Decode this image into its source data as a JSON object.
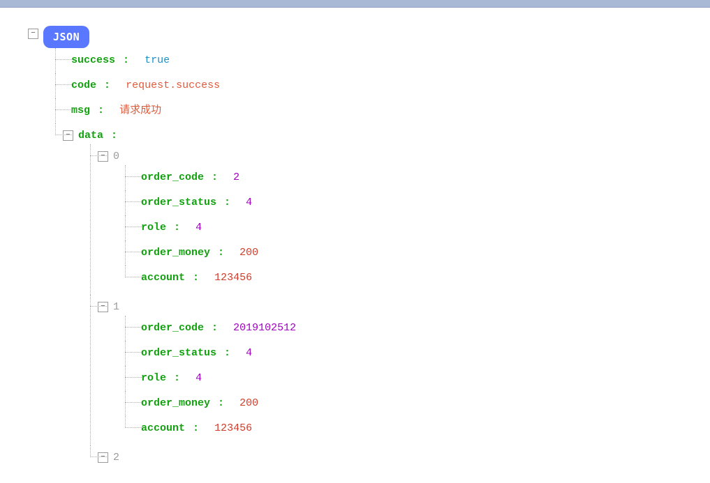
{
  "root_label": "JSON",
  "glyph_expanded": "−",
  "glyph_collapsed": "+",
  "colon": ":",
  "nodes": {
    "success": {
      "key": "success",
      "value": "true",
      "vclass": "v-bool"
    },
    "code": {
      "key": "code",
      "value": "request.success",
      "vclass": "v-str"
    },
    "msg": {
      "key": "msg",
      "value": "请求成功",
      "vclass": "v-str"
    },
    "data": {
      "key": "data"
    },
    "idx0": "0",
    "idx1": "1",
    "idx2": "2",
    "item0": {
      "order_code": {
        "key": "order_code",
        "value": "2",
        "vclass": "v-num"
      },
      "order_status": {
        "key": "order_status",
        "value": "4",
        "vclass": "v-num"
      },
      "role": {
        "key": "role",
        "value": "4",
        "vclass": "v-num"
      },
      "order_money": {
        "key": "order_money",
        "value": "200",
        "vclass": "v-numr"
      },
      "account": {
        "key": "account",
        "value": "123456",
        "vclass": "v-numr"
      }
    },
    "item1": {
      "order_code": {
        "key": "order_code",
        "value": "2019102512",
        "vclass": "v-num"
      },
      "order_status": {
        "key": "order_status",
        "value": "4",
        "vclass": "v-num"
      },
      "role": {
        "key": "role",
        "value": "4",
        "vclass": "v-num"
      },
      "order_money": {
        "key": "order_money",
        "value": "200",
        "vclass": "v-numr"
      },
      "account": {
        "key": "account",
        "value": "123456",
        "vclass": "v-numr"
      }
    }
  }
}
